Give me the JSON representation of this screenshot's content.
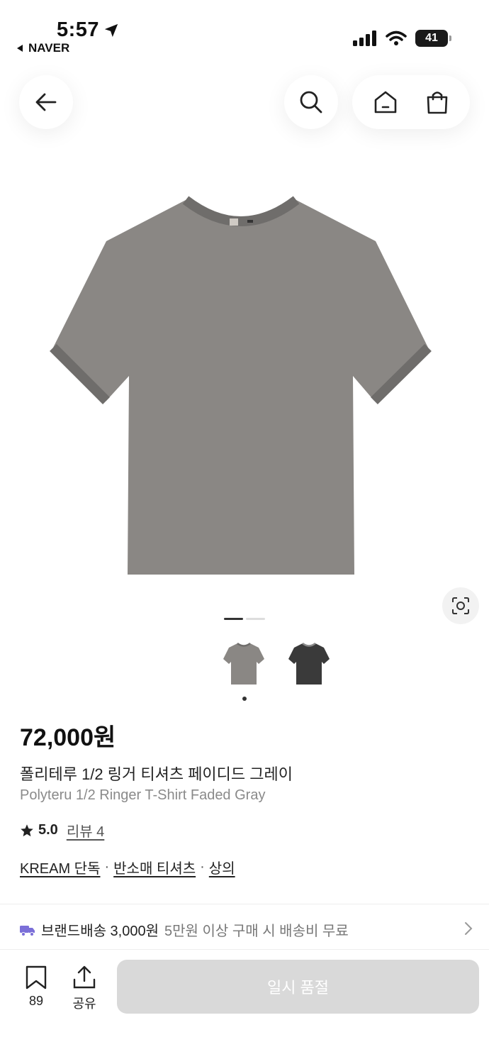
{
  "status_bar": {
    "time": "5:57",
    "back_app": "NAVER",
    "battery": "41"
  },
  "nav": {
    "back_icon": "arrow-left-icon",
    "search_icon": "search-icon",
    "home_icon": "home-icon",
    "cart_icon": "shopping-bag-icon"
  },
  "gallery": {
    "total_pages": 2,
    "current_page": 1,
    "thumbnails": [
      "gray",
      "black"
    ],
    "colors": {
      "gray_shirt": "#8a8784",
      "gray_trim": "#6f6d6b",
      "black_shirt": "#3a3a3a",
      "black_trim": "#8a8a8a"
    }
  },
  "product": {
    "price": "72,000원",
    "name_ko": "폴리테루 1/2 링거 티셔츠 페이디드 그레이",
    "name_en": "Polyteru 1/2 Ringer T-Shirt Faded Gray",
    "rating": "5.0",
    "reviews": "리뷰 4",
    "category": {
      "exclusive": "KREAM 단독",
      "sub": "반소매 티셔츠",
      "main": "상의",
      "separator": "·"
    }
  },
  "shipping": {
    "icon": "truck-icon",
    "title": "브랜드배송 3,000원",
    "desc": "5만원 이상 구매 시 배송비 무료",
    "accent": "#7b6fd8"
  },
  "bottom_bar": {
    "save_count": "89",
    "share_label": "공유",
    "action_label": "일시 품절"
  }
}
